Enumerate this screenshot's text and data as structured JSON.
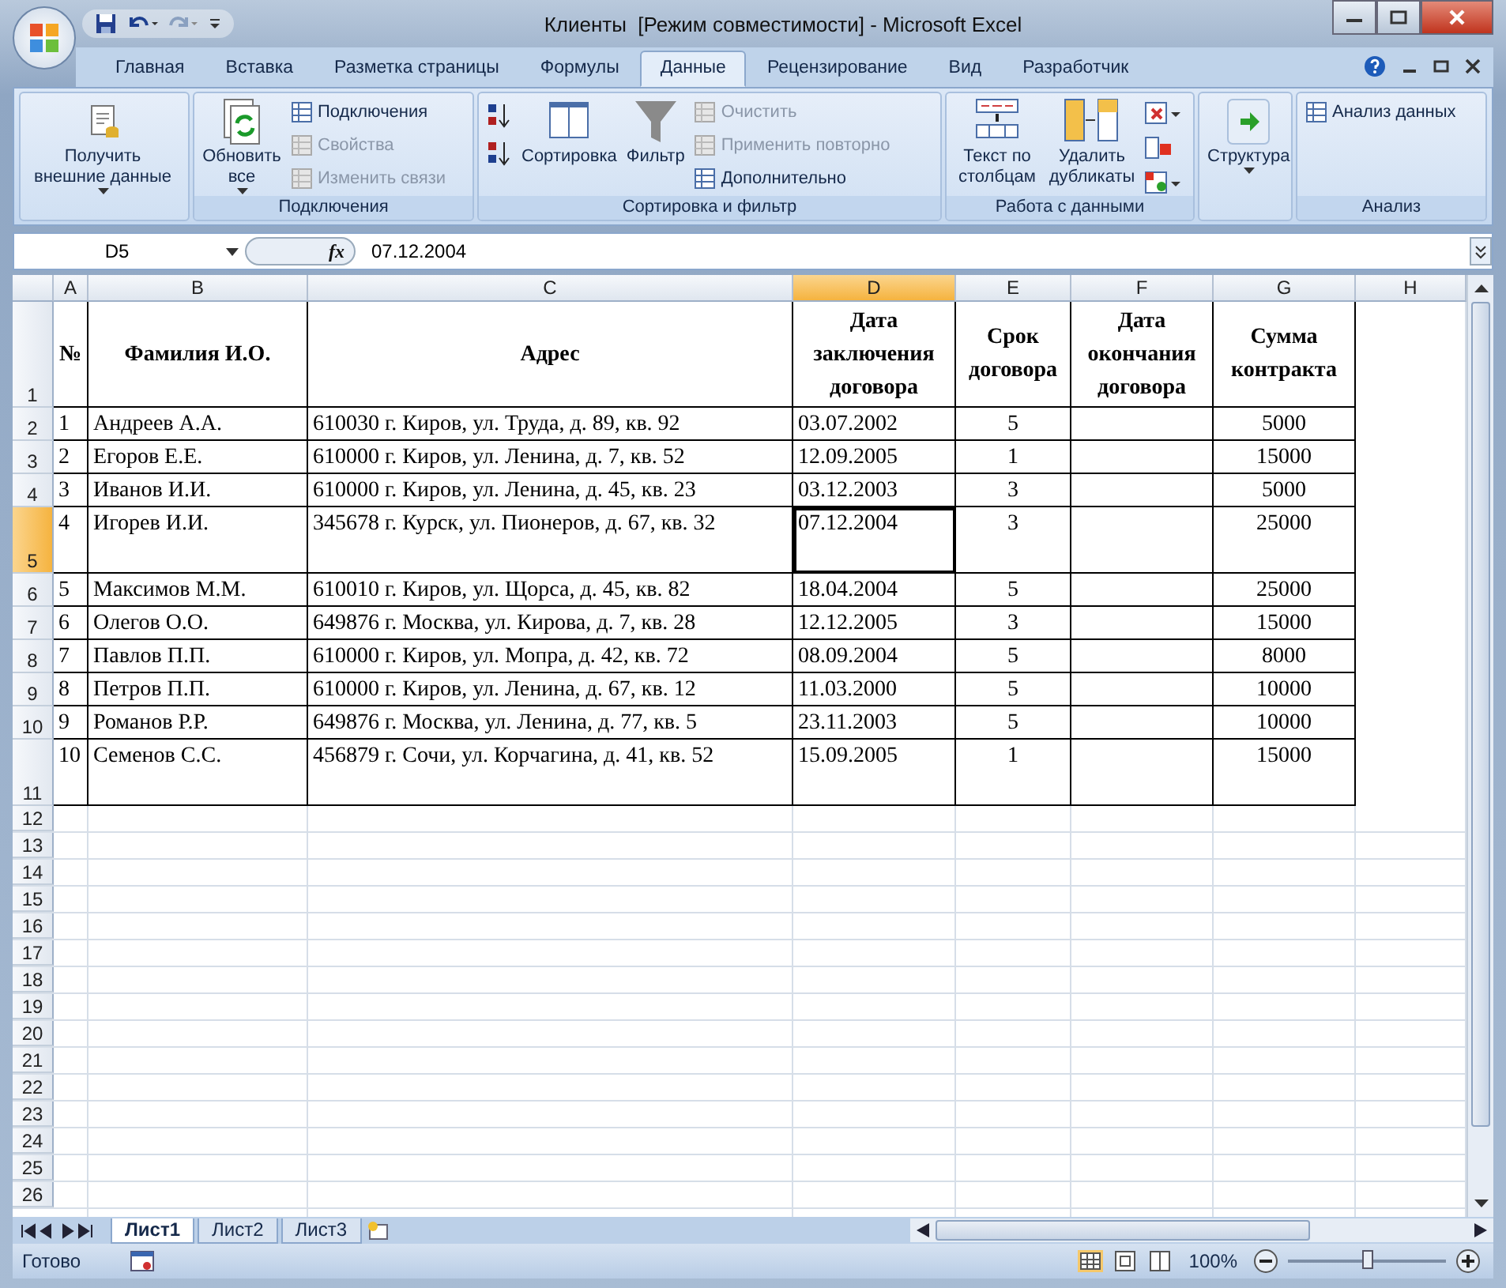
{
  "window": {
    "title": "Клиенты  [Режим совместимости] - Microsoft Excel"
  },
  "tabs": [
    {
      "label": "Главная",
      "selected": false
    },
    {
      "label": "Вставка",
      "selected": false
    },
    {
      "label": "Разметка страницы",
      "selected": false
    },
    {
      "label": "Формулы",
      "selected": false
    },
    {
      "label": "Данные",
      "selected": true
    },
    {
      "label": "Рецензирование",
      "selected": false
    },
    {
      "label": "Вид",
      "selected": false
    },
    {
      "label": "Разработчик",
      "selected": false
    }
  ],
  "ribbon": {
    "groups": [
      {
        "items": [
          {
            "kind": "large",
            "label": "Получить внешние данные",
            "dropdown": true,
            "disabled": false
          }
        ]
      },
      {
        "label": "Подключения",
        "items": [
          {
            "kind": "large",
            "label": "Обновить все",
            "dropdown": true,
            "disabled": false
          },
          {
            "kind": "stack",
            "items": [
              {
                "label": "Подключения",
                "disabled": false
              },
              {
                "label": "Свойства",
                "disabled": true
              },
              {
                "label": "Изменить связи",
                "disabled": true
              }
            ]
          }
        ]
      },
      {
        "label": "Сортировка и фильтр",
        "items": [
          {
            "kind": "sort_icons"
          },
          {
            "kind": "large",
            "label": "Сортировка",
            "dropdown": false,
            "disabled": false
          },
          {
            "kind": "large",
            "label": "Фильтр",
            "dropdown": false,
            "disabled": false
          },
          {
            "kind": "stack",
            "items": [
              {
                "label": "Очистить",
                "disabled": true
              },
              {
                "label": "Применить повторно",
                "disabled": true
              },
              {
                "label": "Дополнительно",
                "disabled": false
              }
            ]
          }
        ]
      },
      {
        "label": "Работа с данными",
        "items": [
          {
            "kind": "large",
            "label": "Текст по столбцам",
            "dropdown": false,
            "disabled": false
          },
          {
            "kind": "large",
            "label": "Удалить дубликаты",
            "dropdown": false,
            "disabled": false
          },
          {
            "kind": "tool_icons"
          }
        ]
      },
      {
        "items": [
          {
            "kind": "large",
            "label": "Структура",
            "dropdown": true,
            "disabled": false
          }
        ]
      },
      {
        "label": "Анализ",
        "items": [
          {
            "kind": "stack",
            "items": [
              {
                "label": "Анализ данных",
                "disabled": false
              }
            ]
          }
        ]
      }
    ]
  },
  "formula_bar": {
    "name_box": "D5",
    "function_label": "fx",
    "value": "07.12.2004"
  },
  "columns": [
    {
      "label": "A",
      "selected": false
    },
    {
      "label": "B",
      "selected": false
    },
    {
      "label": "C",
      "selected": false
    },
    {
      "label": "D",
      "selected": true
    },
    {
      "label": "E",
      "selected": false
    },
    {
      "label": "F",
      "selected": false
    },
    {
      "label": "G",
      "selected": false
    },
    {
      "label": "H",
      "selected": false
    }
  ],
  "rows": [
    {
      "number": "1",
      "kind": "header",
      "selected": false,
      "cells": [
        "№",
        "Фамилия И.О.",
        "Адрес",
        "Дата заключения договора",
        "Срок договора",
        "Дата окончания договора",
        "Сумма контракта"
      ]
    },
    {
      "number": "2",
      "kind": "single",
      "selected": false,
      "cells": [
        "1",
        "Андреев А.А.",
        "610030 г. Киров, ул. Труда, д. 89, кв. 92",
        "03.07.2002",
        "5",
        null,
        "5000"
      ]
    },
    {
      "number": "3",
      "kind": "single",
      "selected": false,
      "cells": [
        "2",
        "Егоров Е.Е.",
        "610000 г. Киров, ул. Ленина, д. 7, кв. 52",
        "12.09.2005",
        "1",
        null,
        "15000"
      ]
    },
    {
      "number": "4",
      "kind": "single",
      "selected": false,
      "cells": [
        "3",
        "Иванов И.И.",
        "610000 г. Киров, ул. Ленина, д. 45, кв. 23",
        "03.12.2003",
        "3",
        null,
        "5000"
      ]
    },
    {
      "number": "5",
      "kind": "double",
      "selected": true,
      "cells": [
        "4",
        "Игорев И.И.",
        "345678 г. Курск, ул. Пионеров, д. 67, кв. 32",
        "07.12.2004",
        "3",
        null,
        "25000"
      ]
    },
    {
      "number": "6",
      "kind": "single",
      "selected": false,
      "cells": [
        "5",
        "Максимов М.М.",
        "610010 г. Киров, ул. Щорса, д. 45, кв. 82",
        "18.04.2004",
        "5",
        null,
        "25000"
      ]
    },
    {
      "number": "7",
      "kind": "single",
      "selected": false,
      "cells": [
        "6",
        "Олегов О.О.",
        "649876 г. Москва, ул. Кирова, д. 7, кв. 28",
        "12.12.2005",
        "3",
        null,
        "15000"
      ]
    },
    {
      "number": "8",
      "kind": "single",
      "selected": false,
      "cells": [
        "7",
        "Павлов П.П.",
        "610000 г. Киров, ул. Мопра, д. 42, кв. 72",
        "08.09.2004",
        "5",
        null,
        "8000"
      ]
    },
    {
      "number": "9",
      "kind": "single",
      "selected": false,
      "cells": [
        "8",
        "Петров П.П.",
        "610000 г. Киров, ул. Ленина, д. 67, кв. 12",
        "11.03.2000",
        "5",
        null,
        "10000"
      ]
    },
    {
      "number": "10",
      "kind": "single",
      "selected": false,
      "cells": [
        "9",
        "Романов Р.Р.",
        "649876 г. Москва, ул. Ленина, д. 77, кв. 5",
        "23.11.2003",
        "5",
        null,
        "10000"
      ]
    },
    {
      "number": "11",
      "kind": "double",
      "selected": false,
      "cells": [
        "10",
        "Семенов С.С.",
        "456879 г. Сочи, ул. Корчагина, д. 41, кв. 52",
        "15.09.2005",
        "1",
        null,
        "15000"
      ]
    },
    {
      "number": "12",
      "kind": "empty",
      "selected": false
    },
    {
      "number": "13",
      "kind": "empty",
      "selected": false
    },
    {
      "number": "14",
      "kind": "empty",
      "selected": false
    },
    {
      "number": "15",
      "kind": "empty",
      "selected": false
    },
    {
      "number": "16",
      "kind": "empty",
      "selected": false
    },
    {
      "number": "17",
      "kind": "empty",
      "selected": false
    },
    {
      "number": "18",
      "kind": "empty",
      "selected": false
    },
    {
      "number": "19",
      "kind": "empty",
      "selected": false
    },
    {
      "number": "20",
      "kind": "empty",
      "selected": false
    },
    {
      "number": "21",
      "kind": "empty",
      "selected": false
    },
    {
      "number": "22",
      "kind": "empty",
      "selected": false
    },
    {
      "number": "23",
      "kind": "empty",
      "selected": false
    },
    {
      "number": "24",
      "kind": "empty",
      "selected": false
    },
    {
      "number": "25",
      "kind": "empty",
      "selected": false
    },
    {
      "number": "26",
      "kind": "empty",
      "selected": false
    }
  ],
  "sheet_tabs": [
    {
      "label": "Лист1",
      "selected": true
    },
    {
      "label": "Лист2",
      "selected": false
    },
    {
      "label": "Лист3",
      "selected": false
    }
  ],
  "status_bar": {
    "status": "Готово",
    "zoom": "100%",
    "zoom_slider": {
      "level": 0.5
    }
  }
}
